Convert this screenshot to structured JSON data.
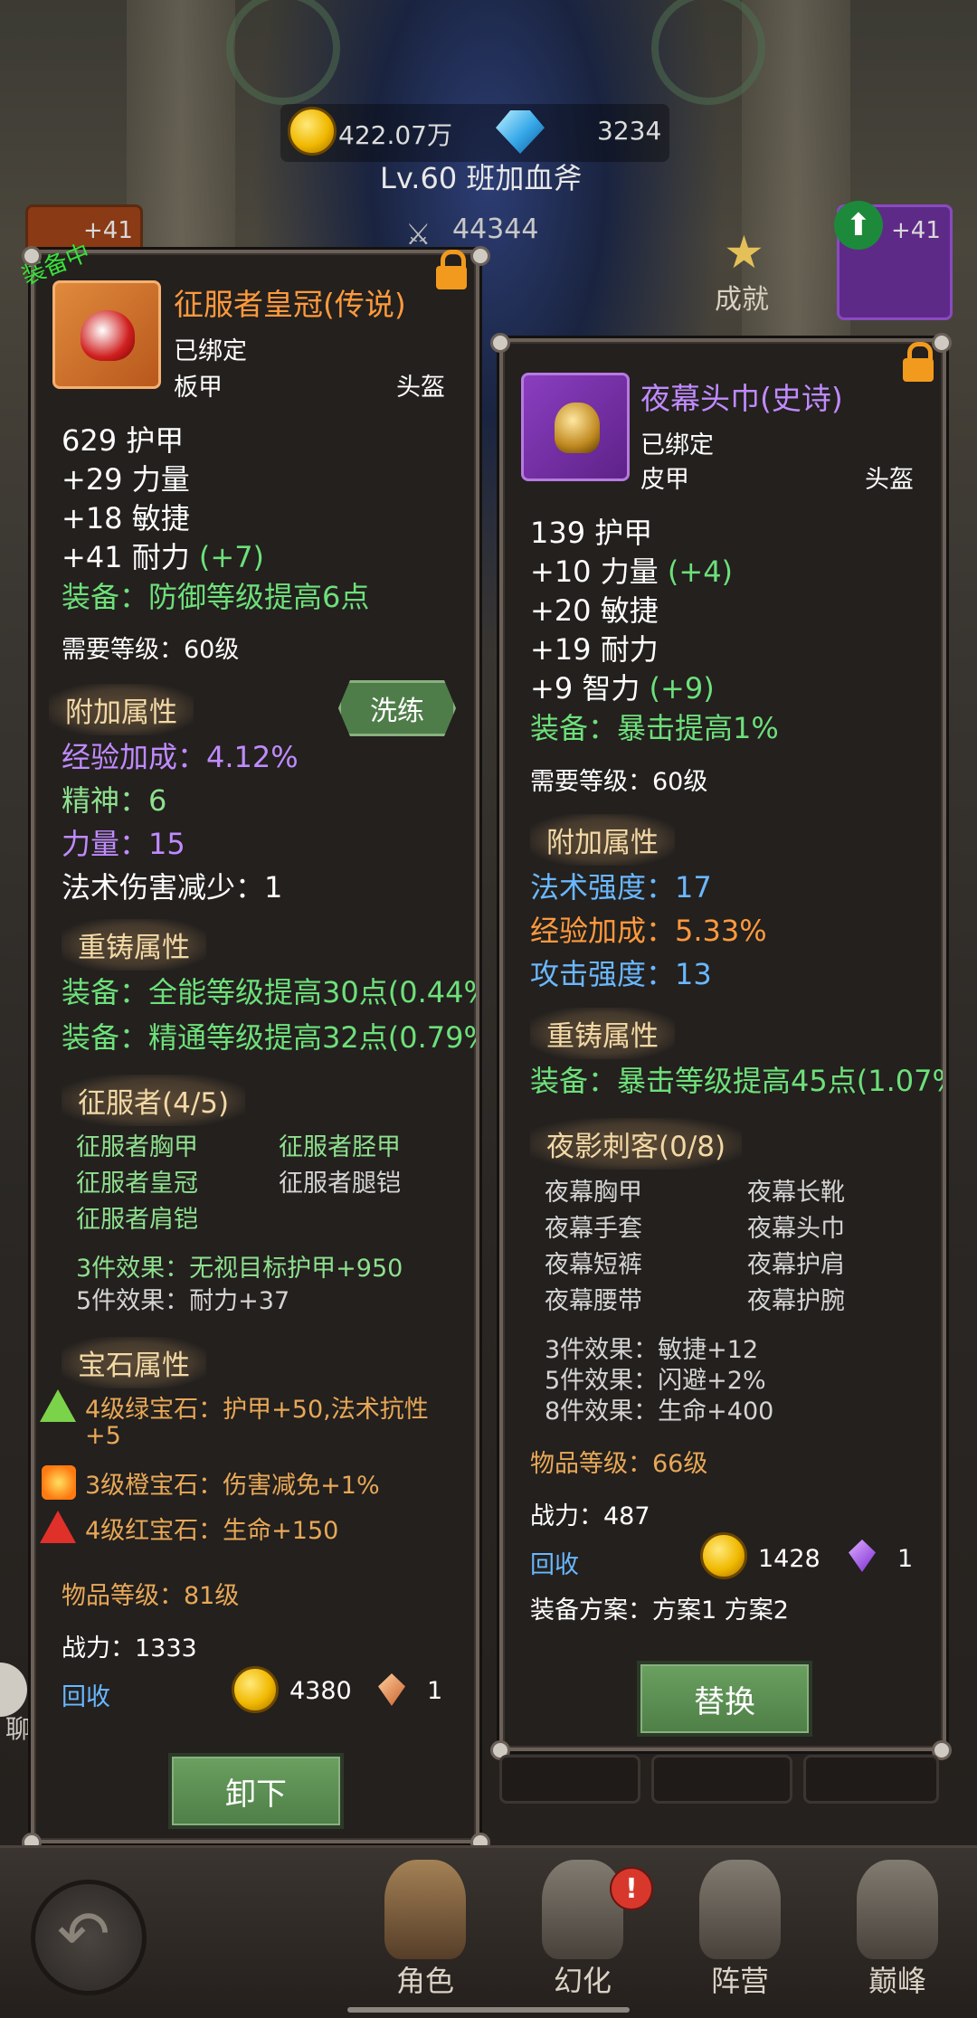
{
  "hud": {
    "gold": "422.07万",
    "diamonds": "3234",
    "level_name": "Lv.60 班加血斧",
    "power": "44344",
    "achievement_label": "成就",
    "slot_left_plus": "+41",
    "slot_right_plus": "+41"
  },
  "left_item": {
    "equipped_badge": "装备中",
    "name": "征服者皇冠(传说)",
    "bound": "已绑定",
    "armor_type": "板甲",
    "slot": "头盔",
    "stats": [
      {
        "text": "629 护甲",
        "bonus": ""
      },
      {
        "text": "+29 力量",
        "bonus": ""
      },
      {
        "text": "+18 敏捷",
        "bonus": ""
      },
      {
        "text": "+41 耐力",
        "bonus": "(+7)"
      }
    ],
    "equip_effect": "装备：防御等级提高6点",
    "req_level": "需要等级：60级",
    "extra_header": "附加属性",
    "refine_label": "洗练",
    "extra_attrs": [
      {
        "text": "经验加成：4.12%",
        "color": "purple"
      },
      {
        "text": "精神：6",
        "color": "lgreen"
      },
      {
        "text": "力量：15",
        "color": "purple"
      },
      {
        "text": "法术伤害减少：1",
        "color": "white"
      }
    ],
    "reforge_header": "重铸属性",
    "reforge_attrs": [
      "装备：全能等级提高30点(0.44%",
      "装备：精通等级提高32点(0.79%"
    ],
    "set_header": "征服者(4/5)",
    "set_items": [
      {
        "name": "征服者胸甲",
        "owned": true
      },
      {
        "name": "征服者胫甲",
        "owned": true
      },
      {
        "name": "征服者皇冠",
        "owned": true
      },
      {
        "name": "征服者腿铠",
        "owned": false
      },
      {
        "name": "征服者肩铠",
        "owned": true
      }
    ],
    "set_bonus_3": "3件效果：无视目标护甲+950",
    "set_bonus_5": "5件效果：耐力+37",
    "gem_header": "宝石属性",
    "gems": [
      {
        "text": "4级绿宝石：护甲+50,法术抗性",
        "text2": "+5"
      },
      {
        "text": "3级橙宝石：伤害减免+1%",
        "text2": ""
      },
      {
        "text": "4级红宝石：生命+150",
        "text2": ""
      }
    ],
    "item_level": "物品等级：81级",
    "power": "战力：1333",
    "recycle_label": "回收",
    "recycle_gold": "4380",
    "recycle_crystal": "1",
    "action_label": "卸下"
  },
  "right_item": {
    "name": "夜幕头巾(史诗)",
    "bound": "已绑定",
    "armor_type": "皮甲",
    "slot": "头盔",
    "stats": [
      {
        "text": "139 护甲",
        "bonus": ""
      },
      {
        "text": "+10 力量",
        "bonus": "(+4)"
      },
      {
        "text": "+20 敏捷",
        "bonus": ""
      },
      {
        "text": "+19 耐力",
        "bonus": ""
      },
      {
        "text": "+9 智力",
        "bonus": "(+9)"
      }
    ],
    "equip_effect": "装备：暴击提高1%",
    "req_level": "需要等级：60级",
    "extra_header": "附加属性",
    "extra_attrs": [
      {
        "text": "法术强度：17",
        "color": "blue"
      },
      {
        "text": "经验加成：5.33%",
        "color": "orange"
      },
      {
        "text": "攻击强度：13",
        "color": "blue"
      }
    ],
    "reforge_header": "重铸属性",
    "reforge_attrs": [
      "装备：暴击等级提高45点(1.07%"
    ],
    "set_header": "夜影刺客(0/8)",
    "set_items": [
      "夜幕胸甲",
      "夜幕长靴",
      "夜幕手套",
      "夜幕头巾",
      "夜幕短裤",
      "夜幕护肩",
      "夜幕腰带",
      "夜幕护腕"
    ],
    "set_bonus_3": "3件效果：敏捷+12",
    "set_bonus_5": "5件效果：闪避+2%",
    "set_bonus_8": "8件效果：生命+400",
    "item_level": "物品等级：66级",
    "power": "战力：487",
    "recycle_label": "回收",
    "recycle_gold": "1428",
    "recycle_crystal": "1",
    "plan": "装备方案：方案1 方案2",
    "action_label": "替换"
  },
  "nav": {
    "items": [
      "角色",
      "幻化",
      "阵营",
      "巅峰"
    ],
    "badge": "!",
    "side_label": "聊"
  }
}
